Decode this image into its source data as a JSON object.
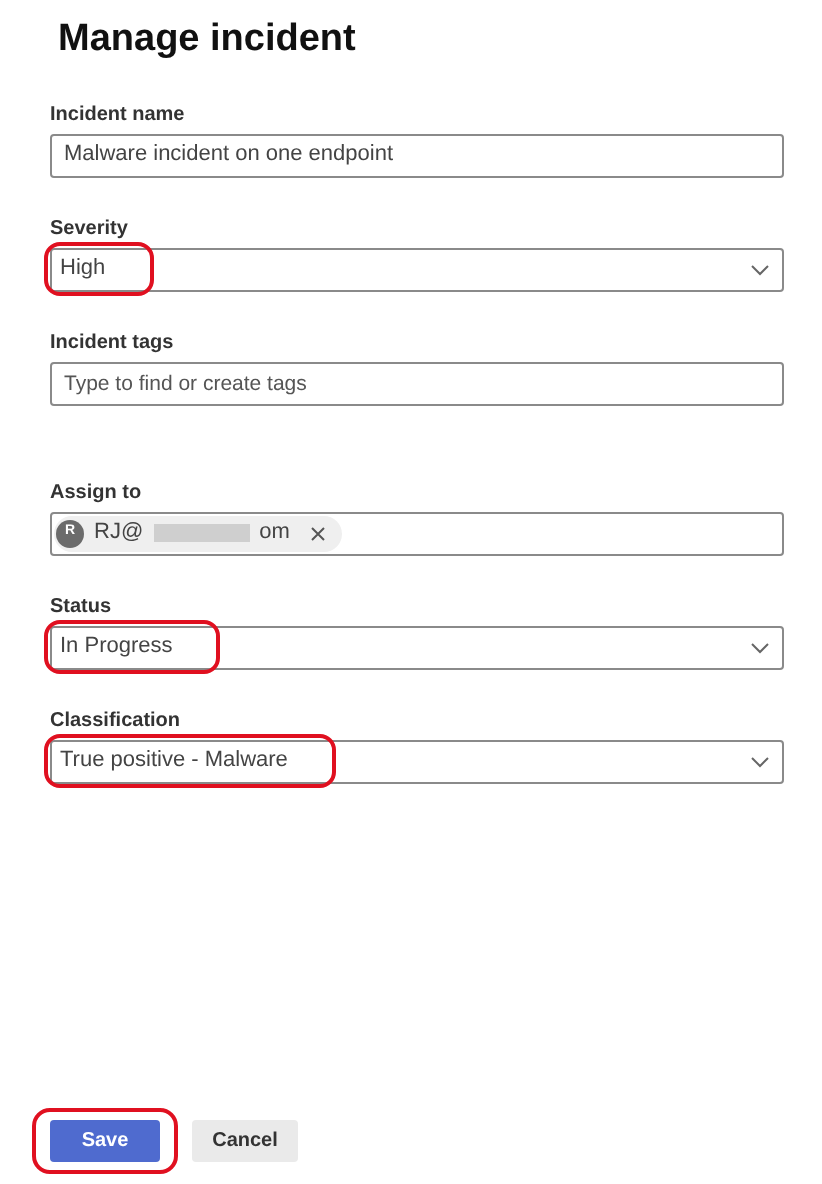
{
  "title": "Manage incident",
  "fields": [
    {
      "kind": "text",
      "label": "Incident name",
      "value": "Malware incident on one endpoint",
      "highlighted": false
    },
    {
      "kind": "select",
      "label": "Severity",
      "value": "High",
      "highlighted": true
    },
    {
      "kind": "tags",
      "label": "Incident tags",
      "placeholder": "Type to find or create tags",
      "highlighted": false
    },
    {
      "kind": "people",
      "label": "Assign to",
      "person": {
        "initial": "R",
        "text_start": "RJ@",
        "text_end": "om"
      },
      "highlighted": false
    },
    {
      "kind": "select",
      "label": "Status",
      "value": "In Progress",
      "highlighted": true
    },
    {
      "kind": "select",
      "label": "Classification",
      "value": "True positive - Malware",
      "highlighted": true
    }
  ],
  "buttons": [
    {
      "label": "Save",
      "primary": true,
      "highlighted": true
    },
    {
      "label": "Cancel",
      "primary": false,
      "highlighted": false
    }
  ]
}
